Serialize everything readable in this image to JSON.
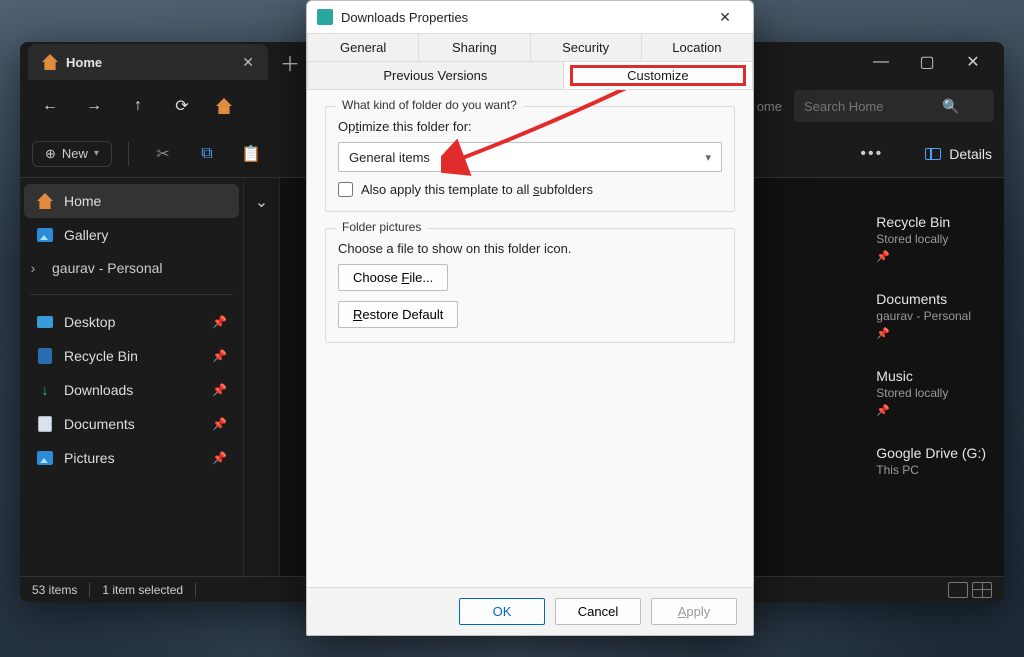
{
  "explorer": {
    "tab": {
      "label": "Home"
    },
    "search_placeholder": "Search Home",
    "address_hint": "ome",
    "new_label": "New",
    "details_label": "Details",
    "sidebar": {
      "home": "Home",
      "gallery": "Gallery",
      "user": "gaurav - Personal",
      "desktop": "Desktop",
      "recycle": "Recycle Bin",
      "downloads": "Downloads",
      "documents": "Documents",
      "pictures": "Pictures"
    },
    "right_items": [
      {
        "title": "Recycle Bin",
        "sub": "Stored locally"
      },
      {
        "title": "Documents",
        "sub": "gaurav - Personal"
      },
      {
        "title": "Music",
        "sub": "Stored locally"
      },
      {
        "title": "Google Drive (G:)",
        "sub": "This PC"
      }
    ],
    "status": {
      "count": "53 items",
      "selected": "1 item selected"
    }
  },
  "dialog": {
    "title": "Downloads Properties",
    "tabs_row1": [
      "General",
      "Sharing",
      "Security",
      "Location"
    ],
    "tabs_row2": [
      "Previous Versions",
      "Customize"
    ],
    "group1_legend": "What kind of folder do you want?",
    "optimize_label_pre": "Op",
    "optimize_label_u": "t",
    "optimize_label_post": "imize this folder for:",
    "combo_value": "General items",
    "subfolders_pre": "Also apply this template to all ",
    "subfolders_u": "s",
    "subfolders_post": "ubfolders",
    "group2_legend": "Folder pictures",
    "group2_text": "Choose a file to show on this folder icon.",
    "choose_pre": "Choose ",
    "choose_u": "F",
    "choose_post": "ile...",
    "restore_u": "R",
    "restore_post": "estore Default",
    "ok": "OK",
    "cancel": "Cancel",
    "apply_u": "A",
    "apply_post": "pply"
  }
}
